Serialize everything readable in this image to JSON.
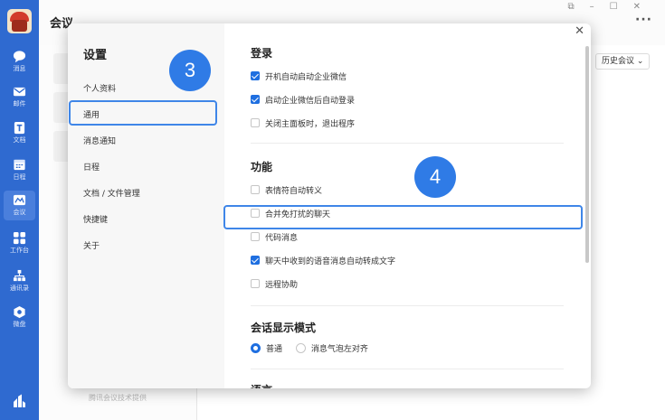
{
  "app": {
    "title": "会议"
  },
  "window_controls": [
    "restore",
    "minimize",
    "maximize",
    "close"
  ],
  "rail": {
    "items": [
      {
        "label": "消息",
        "icon": "message-icon"
      },
      {
        "label": "邮件",
        "icon": "mail-icon"
      },
      {
        "label": "文档",
        "icon": "doc-icon"
      },
      {
        "label": "日程",
        "icon": "calendar-icon"
      },
      {
        "label": "会议",
        "icon": "meeting-icon",
        "active": true
      },
      {
        "label": "工作台",
        "icon": "workbench-icon"
      },
      {
        "label": "通讯录",
        "icon": "contacts-icon"
      },
      {
        "label": "微盘",
        "icon": "drive-icon"
      }
    ]
  },
  "main": {
    "history_button": "历史会议",
    "footnote": "腾讯会议技术提供"
  },
  "settings": {
    "title": "设置",
    "menu": [
      "个人资料",
      "通用",
      "消息通知",
      "日程",
      "文档 / 文件管理",
      "快捷键",
      "关于"
    ],
    "selected_menu": "通用",
    "sections": {
      "login": {
        "title": "登录",
        "options": [
          {
            "label": "开机自动启动企业微信",
            "checked": true
          },
          {
            "label": "启动企业微信后自动登录",
            "checked": true
          },
          {
            "label": "关闭主面板时，退出程序",
            "checked": false
          }
        ]
      },
      "features": {
        "title": "功能",
        "options": [
          {
            "label": "表情符自动转义",
            "checked": false
          },
          {
            "label": "合并免打扰的聊天",
            "checked": false
          },
          {
            "label": "代码消息",
            "checked": false
          },
          {
            "label": "聊天中收到的语音消息自动转成文字",
            "checked": true
          },
          {
            "label": "远程协助",
            "checked": false
          }
        ]
      },
      "display": {
        "title": "会话显示模式",
        "options": [
          {
            "label": "普通",
            "selected": true
          },
          {
            "label": "消息气泡左对齐",
            "selected": false
          }
        ]
      },
      "language": {
        "title": "语言"
      }
    }
  },
  "annotations": {
    "badge_left": "3",
    "badge_right": "4"
  },
  "colors": {
    "rail": "#2f6ad0",
    "accent": "#1f6fe0",
    "badge": "#2f7be6"
  }
}
